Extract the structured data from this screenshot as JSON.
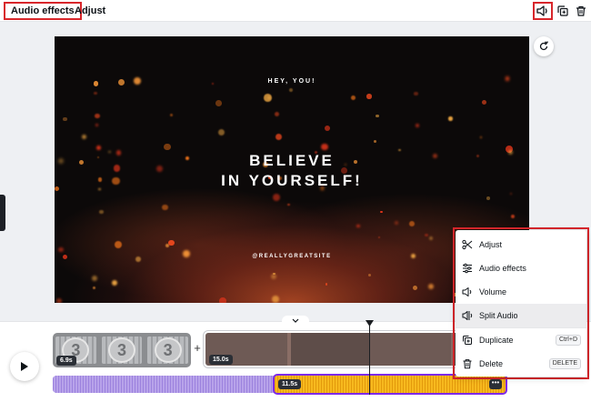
{
  "toolbar": {
    "audio_effects_tab": "Audio effects",
    "adjust_tab": "Adjust",
    "icons": [
      "speaker-icon",
      "copy-icon",
      "trash-icon"
    ]
  },
  "canvas": {
    "greeting": "HEY, YOU!",
    "headline_line1": "BELIEVE",
    "headline_line2": "IN YOURSELF!",
    "handle": "@REALLYGREATSITE"
  },
  "timeline": {
    "clip1_duration": "6.9s",
    "clip1_frame_number": "3",
    "clip2_duration": "15.0s",
    "audio_duration": "11.5s",
    "audio_more_label": "•••",
    "add_label": "+"
  },
  "context_menu": {
    "items": [
      {
        "label": "Adjust",
        "icon": "scissors-icon"
      },
      {
        "label": "Audio effects",
        "icon": "sliders-icon"
      },
      {
        "label": "Volume",
        "icon": "volume-icon"
      },
      {
        "label": "Split Audio",
        "icon": "split-icon"
      },
      {
        "label": "Duplicate",
        "icon": "duplicate-icon",
        "shortcut": "Ctrl+D"
      },
      {
        "label": "Delete",
        "icon": "trash-icon",
        "shortcut": "DELETE"
      }
    ]
  },
  "colors": {
    "highlight_red": "#d8262b",
    "selection_purple": "#7d2ae8",
    "audio_yellow": "#f7b91e",
    "audio_lavender": "#b8a3ea"
  }
}
